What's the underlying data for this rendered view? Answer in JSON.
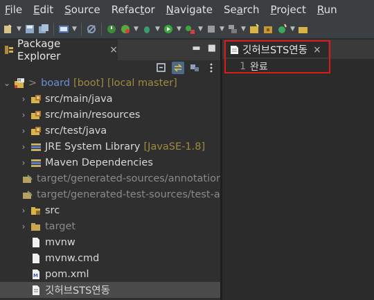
{
  "menu": [
    "File",
    "Edit",
    "Source",
    "Refactor",
    "Navigate",
    "Search",
    "Project",
    "Run"
  ],
  "menu_mnemonic": [
    "F",
    "E",
    "S",
    "t",
    "N",
    "a",
    "P",
    "R"
  ],
  "package_explorer": {
    "tab_label": "Package Explorer",
    "close_glyph": "×",
    "project": {
      "prefix": ">",
      "name": "board",
      "boot": "[boot]",
      "repo": "[local master]"
    },
    "items": [
      {
        "label": "src/main/java",
        "icon": "package-folder-icon",
        "expandable": true,
        "dim": false
      },
      {
        "label": "src/main/resources",
        "icon": "package-folder-icon",
        "expandable": true,
        "dim": false
      },
      {
        "label": "src/test/java",
        "icon": "package-folder-icon",
        "expandable": true,
        "dim": false
      },
      {
        "label": "JRE System Library",
        "icon": "library-icon",
        "expandable": true,
        "dim": false,
        "deco": "[JavaSE-1.8]"
      },
      {
        "label": "Maven Dependencies",
        "icon": "library-icon",
        "expandable": true,
        "dim": false
      },
      {
        "label": "target/generated-sources/annotations",
        "icon": "generated-folder-icon",
        "expandable": false,
        "dim": true
      },
      {
        "label": "target/generated-test-sources/test-annotations",
        "icon": "generated-folder-icon",
        "expandable": false,
        "dim": true
      },
      {
        "label": "src",
        "icon": "src-folder-icon",
        "expandable": true,
        "dim": false
      },
      {
        "label": "target",
        "icon": "folder-icon",
        "expandable": true,
        "dim": true
      },
      {
        "label": "mvnw",
        "icon": "file-icon",
        "expandable": false,
        "dim": false
      },
      {
        "label": "mvnw.cmd",
        "icon": "file-icon",
        "expandable": false,
        "dim": false
      },
      {
        "label": "pom.xml",
        "icon": "xml-file-icon",
        "expandable": false,
        "dim": false
      },
      {
        "label": "깃허브STS연동",
        "icon": "text-file-icon",
        "expandable": false,
        "dim": false,
        "selected": true
      }
    ]
  },
  "editor": {
    "tab_label": "깃허브STS연동",
    "close_glyph": "×",
    "lines": [
      {
        "num": "1",
        "text": "완료"
      }
    ]
  },
  "colors": {
    "highlight": "#e01818",
    "accent": "#4a6b8a"
  }
}
